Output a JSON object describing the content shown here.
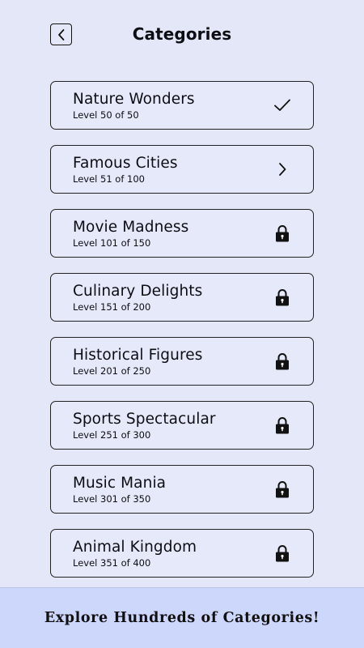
{
  "header": {
    "title": "Categories",
    "back_icon": "chevron-left-icon"
  },
  "categories": [
    {
      "title": "Nature Wonders",
      "level": "Level 50 of 50",
      "status": "completed",
      "icon": "checkmark-icon"
    },
    {
      "title": "Famous Cities",
      "level": "Level 51 of 100",
      "status": "current",
      "icon": "chevron-right-icon"
    },
    {
      "title": "Movie Madness",
      "level": "Level 101 of 150",
      "status": "locked",
      "icon": "lock-icon"
    },
    {
      "title": "Culinary Delights",
      "level": "Level 151 of 200",
      "status": "locked",
      "icon": "lock-icon"
    },
    {
      "title": "Historical Figures",
      "level": "Level 201 of 250",
      "status": "locked",
      "icon": "lock-icon"
    },
    {
      "title": "Sports Spectacular",
      "level": "Level 251 of 300",
      "status": "locked",
      "icon": "lock-icon"
    },
    {
      "title": "Music Mania",
      "level": "Level 301 of 350",
      "status": "locked",
      "icon": "lock-icon"
    },
    {
      "title": "Animal Kingdom",
      "level": "Level 351 of 400",
      "status": "locked",
      "icon": "lock-icon"
    }
  ],
  "footer": {
    "text": "Explore Hundreds of Categories!"
  },
  "colors": {
    "background": "#e3e7f8",
    "footer_background": "#cdd6fb",
    "text": "#0d0d14"
  }
}
